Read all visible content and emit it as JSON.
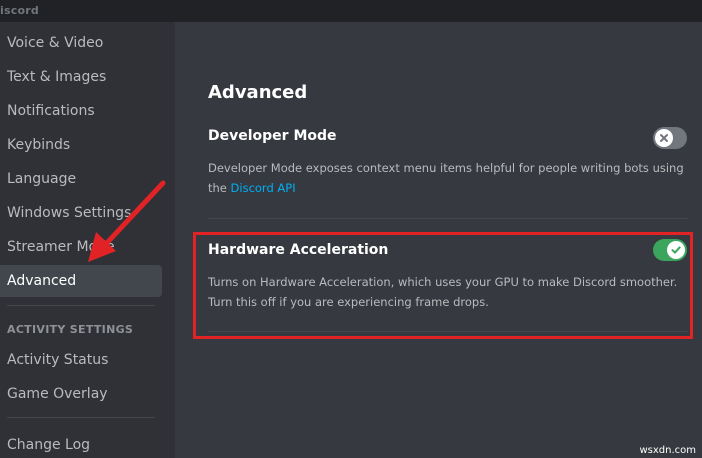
{
  "app": {
    "title": "iscord"
  },
  "sidebar": {
    "items": [
      {
        "label": "Voice & Video"
      },
      {
        "label": "Text & Images"
      },
      {
        "label": "Notifications"
      },
      {
        "label": "Keybinds"
      },
      {
        "label": "Language"
      },
      {
        "label": "Windows Settings"
      },
      {
        "label": "Streamer Mode"
      },
      {
        "label": "Advanced",
        "selected": true
      }
    ],
    "activity_header": "ACTIVITY SETTINGS",
    "activity_items": [
      {
        "label": "Activity Status"
      },
      {
        "label": "Game Overlay"
      }
    ],
    "change_log": "Change Log"
  },
  "main": {
    "title": "Advanced",
    "developer_mode": {
      "title": "Developer Mode",
      "description": "Developer Mode exposes context menu items helpful for people writing bots using the ",
      "link_text": "Discord API",
      "enabled": false
    },
    "hardware_acceleration": {
      "title": "Hardware Acceleration",
      "description": "Turns on Hardware Acceleration, which uses your GPU to make Discord smoother. Turn this off if you are experiencing frame drops.",
      "enabled": true
    }
  },
  "annotation": {
    "highlight_color": "#e22326"
  },
  "colors": {
    "sidebar_bg": "#2f3136",
    "content_bg": "#36393f",
    "toggle_on": "#3ba55d",
    "toggle_off": "#72767d",
    "link": "#00aff4"
  },
  "watermark": "wsxdn.com"
}
